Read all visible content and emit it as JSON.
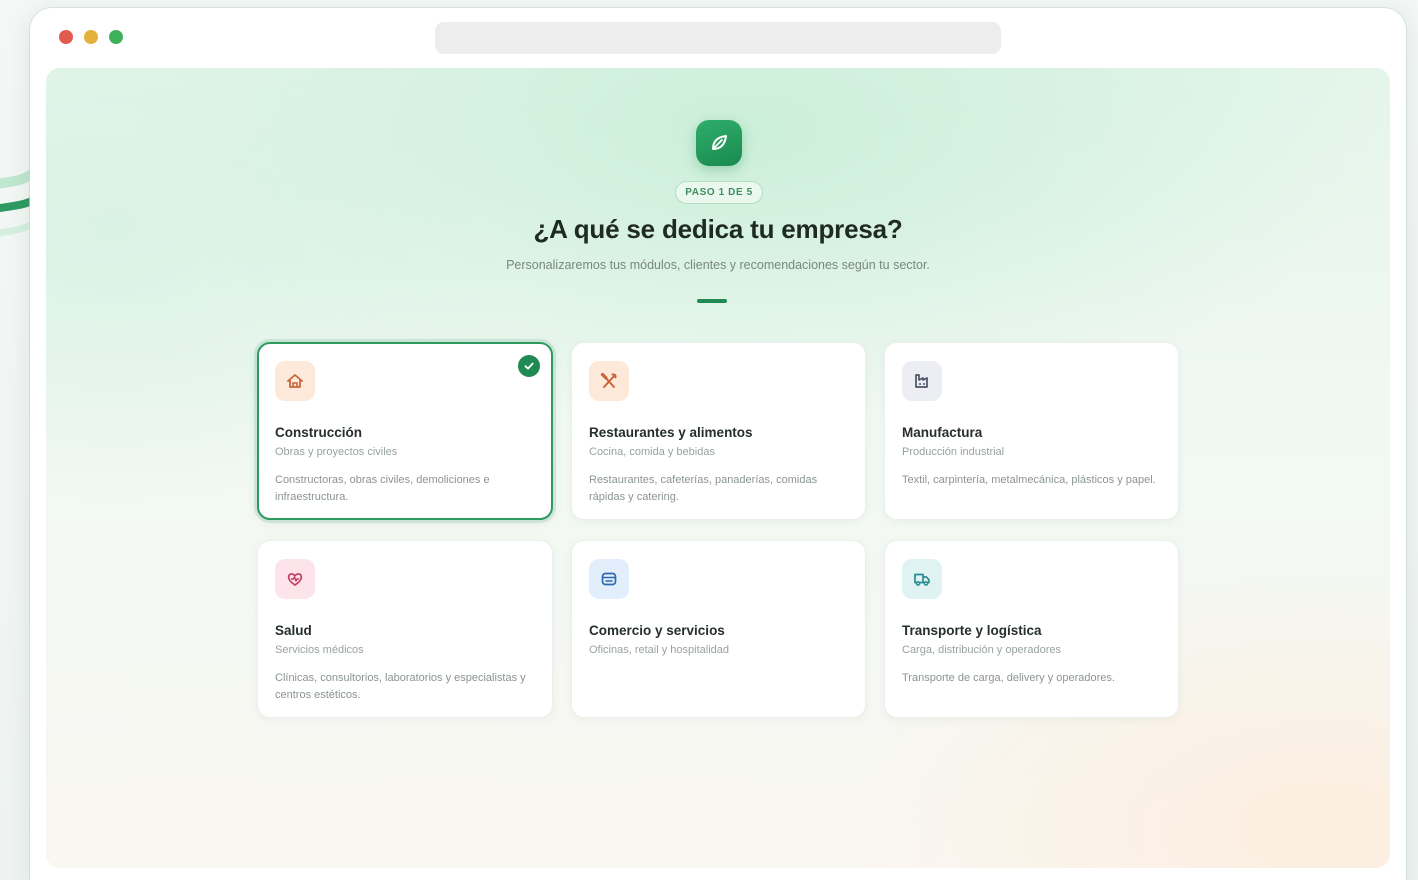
{
  "header": {
    "step_label": "PASO 1 DE 5",
    "title": "¿A qué se dedica tu empresa?",
    "subtitle": "Personalizaremos tus módulos, clientes y recomendaciones según tu sector."
  },
  "industries": [
    {
      "title": "Construcción",
      "subtitle": "Obras y proyectos civiles",
      "description": "Constructoras, obras civiles, demoliciones e infraestructura.",
      "icon": "house-icon",
      "icon_bg": "#fde9da",
      "icon_color": "#c8663a",
      "selected": true
    },
    {
      "title": "Restaurantes y alimentos",
      "subtitle": "Cocina, comida y bebidas",
      "description": "Restaurantes, cafeterías, panaderías, comidas rápidas y catering.",
      "icon": "utensils-icon",
      "icon_bg": "#fde9da",
      "icon_color": "#c8663a",
      "selected": false
    },
    {
      "title": "Manufactura",
      "subtitle": "Producción industrial",
      "description": "Textil, carpintería, metalmecánica, plásticos y papel.",
      "icon": "factory-icon",
      "icon_bg": "#eceef3",
      "icon_color": "#4a5468",
      "selected": false
    },
    {
      "title": "Salud",
      "subtitle": "Servicios médicos",
      "description": "Clínicas, consultorios, laboratorios y especialistas y centros estéticos.",
      "icon": "heart-icon",
      "icon_bg": "#fde4ea",
      "icon_color": "#c23f63",
      "selected": false
    },
    {
      "title": "Comercio y servicios",
      "subtitle": "Oficinas, retail y hospitalidad",
      "description": "",
      "icon": "store-icon",
      "icon_bg": "#e2eefb",
      "icon_color": "#2f67b0",
      "selected": false
    },
    {
      "title": "Transporte y logística",
      "subtitle": "Carga, distribución y operadores",
      "description": "Transporte de carga, delivery y operadores.",
      "icon": "truck-icon",
      "icon_bg": "#dff3f3",
      "icon_color": "#2a8c8e",
      "selected": false
    }
  ],
  "theme": {
    "accent": "#1f8a52"
  }
}
